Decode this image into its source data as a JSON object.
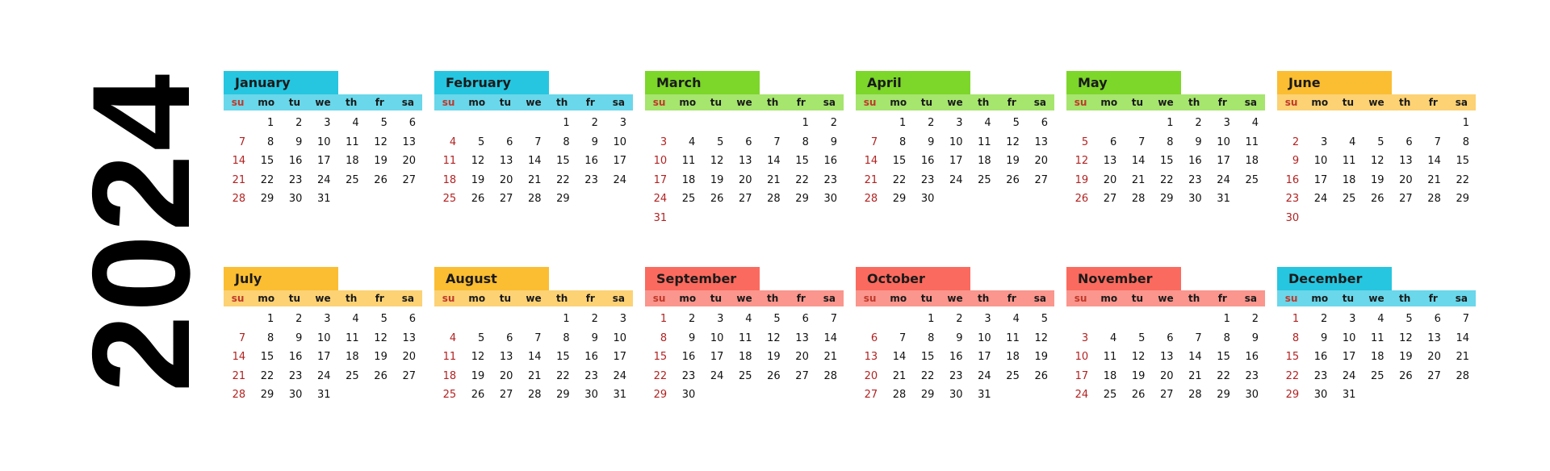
{
  "year": "2024",
  "weekday_labels": [
    "su",
    "mo",
    "tu",
    "we",
    "th",
    "fr",
    "sa"
  ],
  "months": [
    {
      "name": "January",
      "color": "#26c6e0",
      "light": "#6ad7ea",
      "start": 1,
      "days": 31
    },
    {
      "name": "February",
      "color": "#26c6e0",
      "light": "#6ad7ea",
      "start": 4,
      "days": 29
    },
    {
      "name": "March",
      "color": "#7dd62a",
      "light": "#a6e56e",
      "start": 5,
      "days": 31
    },
    {
      "name": "April",
      "color": "#7dd62a",
      "light": "#a6e56e",
      "start": 1,
      "days": 30
    },
    {
      "name": "May",
      "color": "#7dd62a",
      "light": "#a6e56e",
      "start": 3,
      "days": 31
    },
    {
      "name": "June",
      "color": "#fbbd32",
      "light": "#fcd274",
      "start": 6,
      "days": 30
    },
    {
      "name": "July",
      "color": "#fbbd32",
      "light": "#fcd274",
      "start": 1,
      "days": 31
    },
    {
      "name": "August",
      "color": "#fbbd32",
      "light": "#fcd274",
      "start": 4,
      "days": 31
    },
    {
      "name": "September",
      "color": "#fb6a5e",
      "light": "#fa968d",
      "start": 0,
      "days": 30
    },
    {
      "name": "October",
      "color": "#fb6a5e",
      "light": "#fa968d",
      "start": 2,
      "days": 31
    },
    {
      "name": "November",
      "color": "#fb6a5e",
      "light": "#fa968d",
      "start": 5,
      "days": 30
    },
    {
      "name": "December",
      "color": "#26c6e0",
      "light": "#6ad7ea",
      "start": 0,
      "days": 31
    }
  ]
}
